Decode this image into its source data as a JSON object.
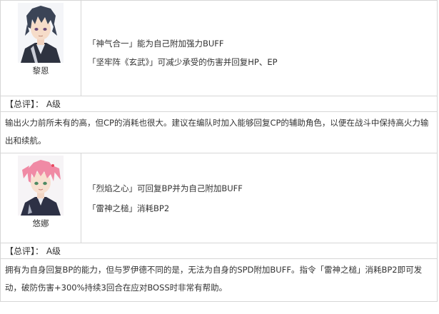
{
  "characters": [
    {
      "name": "黎恩",
      "skills": [
        "「神气合一」能为自己附加强力BUFF",
        "「坚牢阵《玄武》」可减少承受的伤害并回复HP、EP"
      ],
      "rating_label": "【总评】：",
      "rating_grade": "A级",
      "description": "输出火力前所未有的高，但CP的消耗也很大。建议在编队时加入能够回复CP的辅助角色，以便在战斗中保持高火力输出和续航。"
    },
    {
      "name": "悠娜",
      "skills": [
        "「烈焰之心」可回复BP并为自己附加BUFF",
        "「雷神之槌」消耗BP2"
      ],
      "rating_label": "【总评】：",
      "rating_grade": "A级",
      "description": "拥有为自身回复BP的能力，但与罗伊德不同的是，无法为自身的SPD附加BUFF。指令「雷神之槌」消耗BP2即可发动，破防伤害+300%持续3回合在应对BOSS时非常有帮助。"
    }
  ],
  "colors": {
    "border": "#d6d6d6",
    "text": "#333333",
    "rean_hair": "#3b4456",
    "rean_coat": "#2e3340",
    "juna_hair": "#f08aa5",
    "juna_coat": "#2d3145"
  }
}
